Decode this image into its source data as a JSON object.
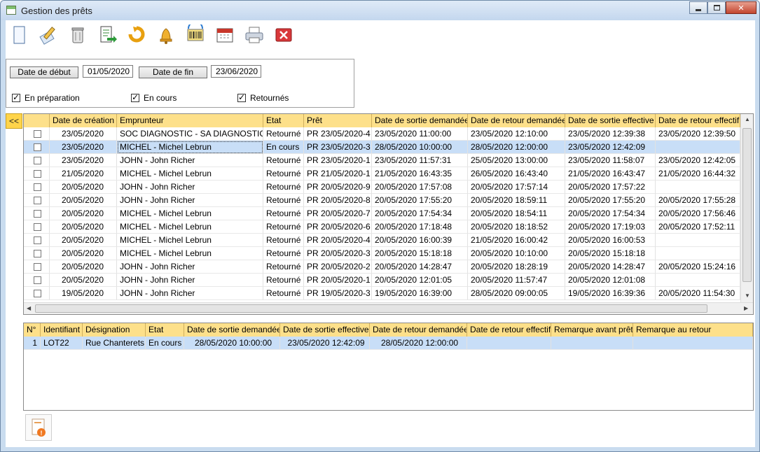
{
  "window": {
    "title": "Gestion des prêts",
    "close_glyph": "✕"
  },
  "toolbar": [
    {
      "name": "new-document-icon",
      "tooltip": ""
    },
    {
      "name": "edit-pencil-icon",
      "tooltip": ""
    },
    {
      "name": "trash-can-icon",
      "tooltip": ""
    },
    {
      "name": "export-sheet-icon",
      "tooltip": ""
    },
    {
      "name": "return-arrow-icon",
      "tooltip": ""
    },
    {
      "name": "bell-icon",
      "tooltip": ""
    },
    {
      "name": "barcode-scan-icon",
      "tooltip": ""
    },
    {
      "name": "calendar-icon",
      "tooltip": ""
    },
    {
      "name": "printer-icon",
      "tooltip": ""
    },
    {
      "name": "close-x-icon",
      "tooltip": ""
    }
  ],
  "filters": {
    "start_label": "Date de début",
    "start_value": "01/05/2020",
    "end_label": "Date de fin",
    "end_value": "23/06/2020",
    "checks": [
      {
        "label": "En préparation",
        "checked": true
      },
      {
        "label": "En cours",
        "checked": true
      },
      {
        "label": "Retournés",
        "checked": true
      }
    ]
  },
  "collapse_label": "<<",
  "loans": {
    "columns": [
      "",
      "Date de création",
      "Emprunteur",
      "Etat",
      "Prêt",
      "Date de sortie demandée",
      "Date de retour demandée",
      "Date de sortie effective",
      "Date de retour effectif"
    ],
    "rows": [
      [
        "23/05/2020",
        "SOC DIAGNOSTIC - SA DIAGNOSTIC",
        "Retourné",
        "PR 23/05/2020-4",
        "23/05/2020 11:00:00",
        "23/05/2020 12:10:00",
        "23/05/2020 12:39:38",
        "23/05/2020 12:39:50"
      ],
      [
        "23/05/2020",
        "MICHEL - Michel Lebrun",
        "En cours",
        "PR 23/05/2020-3",
        "28/05/2020 10:00:00",
        "28/05/2020 12:00:00",
        "23/05/2020 12:42:09",
        ""
      ],
      [
        "23/05/2020",
        "JOHN - John Richer",
        "Retourné",
        "PR 23/05/2020-1",
        "23/05/2020 11:57:31",
        "25/05/2020 13:00:00",
        "23/05/2020 11:58:07",
        "23/05/2020 12:42:05"
      ],
      [
        "21/05/2020",
        "MICHEL - Michel Lebrun",
        "Retourné",
        "PR 21/05/2020-1",
        "21/05/2020 16:43:35",
        "26/05/2020 16:43:40",
        "21/05/2020 16:43:47",
        "21/05/2020 16:44:32"
      ],
      [
        "20/05/2020",
        "JOHN - John Richer",
        "Retourné",
        "PR 20/05/2020-9",
        "20/05/2020 17:57:08",
        "20/05/2020 17:57:14",
        "20/05/2020 17:57:22",
        ""
      ],
      [
        "20/05/2020",
        "JOHN - John Richer",
        "Retourné",
        "PR 20/05/2020-8",
        "20/05/2020 17:55:20",
        "20/05/2020 18:59:11",
        "20/05/2020 17:55:20",
        "20/05/2020 17:55:28"
      ],
      [
        "20/05/2020",
        "MICHEL - Michel Lebrun",
        "Retourné",
        "PR 20/05/2020-7",
        "20/05/2020 17:54:34",
        "20/05/2020 18:54:11",
        "20/05/2020 17:54:34",
        "20/05/2020 17:56:46"
      ],
      [
        "20/05/2020",
        "MICHEL - Michel Lebrun",
        "Retourné",
        "PR 20/05/2020-6",
        "20/05/2020 17:18:48",
        "20/05/2020 18:18:52",
        "20/05/2020 17:19:03",
        "20/05/2020 17:52:11"
      ],
      [
        "20/05/2020",
        "MICHEL - Michel Lebrun",
        "Retourné",
        "PR 20/05/2020-4",
        "20/05/2020 16:00:39",
        "21/05/2020 16:00:42",
        "20/05/2020 16:00:53",
        ""
      ],
      [
        "20/05/2020",
        "MICHEL - Michel Lebrun",
        "Retourné",
        "PR 20/05/2020-3",
        "20/05/2020 15:18:18",
        "20/05/2020 10:10:00",
        "20/05/2020 15:18:18",
        ""
      ],
      [
        "20/05/2020",
        "JOHN - John Richer",
        "Retourné",
        "PR 20/05/2020-2",
        "20/05/2020 14:28:47",
        "20/05/2020 18:28:19",
        "20/05/2020 14:28:47",
        "20/05/2020 15:24:16"
      ],
      [
        "20/05/2020",
        "JOHN - John Richer",
        "Retourné",
        "PR 20/05/2020-1",
        "20/05/2020 12:01:05",
        "20/05/2020 11:57:47",
        "20/05/2020 12:01:08",
        ""
      ],
      [
        "19/05/2020",
        "JOHN - John Richer",
        "Retourné",
        "PR 19/05/2020-3",
        "19/05/2020 16:39:00",
        "28/05/2020 09:00:05",
        "19/05/2020 16:39:36",
        "20/05/2020 11:54:30"
      ]
    ],
    "selected_row": 1
  },
  "details": {
    "columns": [
      "N°",
      "Identifiant",
      "Désignation",
      "Etat",
      "Date de sortie demandée",
      "Date de sortie effective",
      "Date de retour demandée",
      "Date de retour effectif",
      "Remarque avant prêt",
      "Remarque au retour"
    ],
    "rows": [
      [
        "1",
        "LOT22",
        "Rue Chanterets",
        "En cours",
        "28/05/2020 10:00:00",
        "23/05/2020 12:42:09",
        "28/05/2020 12:00:00",
        "",
        "",
        ""
      ]
    ]
  },
  "footer_button": {
    "icon": "alert-document-icon"
  },
  "colors": {
    "header": "#fde08a",
    "selection": "#c8def7",
    "accent": "#ffd44a"
  }
}
